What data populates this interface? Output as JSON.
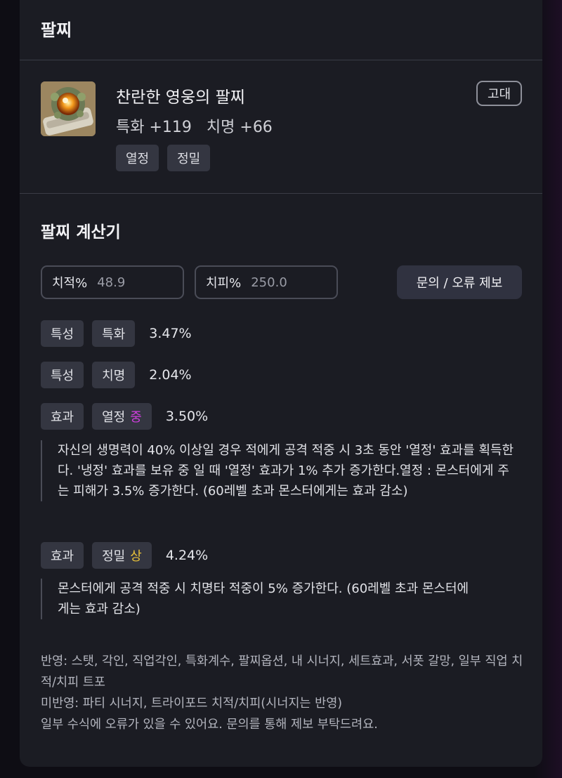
{
  "header": {
    "title": "팔찌"
  },
  "item": {
    "name": "찬란한 영웅의 팔찌",
    "stats": [
      "특화 +119",
      "치명 +66"
    ],
    "tags": [
      "열정",
      "정밀"
    ],
    "grade": "고대"
  },
  "calculator": {
    "title": "팔찌 계산기",
    "crit_rate": {
      "label": "치적%",
      "value": "48.9"
    },
    "crit_damage": {
      "label": "치피%",
      "value": "250.0"
    },
    "report_button": "문의 / 오류 제보",
    "rows": [
      {
        "kind": "특성",
        "name": "특화",
        "value": "3.47%"
      },
      {
        "kind": "특성",
        "name": "치명",
        "value": "2.04%"
      },
      {
        "kind": "효과",
        "name": "열정",
        "grade": "중",
        "value": "3.50%",
        "desc": "자신의 생명력이 40% 이상일 경우 적에게 공격 적중 시 3초 동안 '열정' 효과를 획득한다. '냉정' 효과를 보유 중 일 때 '열정' 효과가 1% 추가 증가한다.열정 : 몬스터에게 주는 피해가 3.5% 증가한다. (60레벨 초과 몬스터에게는 효과 감소)"
      },
      {
        "kind": "효과",
        "name": "정밀",
        "grade": "상",
        "value": "4.24%",
        "desc": "몬스터에게 공격 적중 시 치명타 적중이 5% 증가한다. (60레벨 초과 몬스터에게는 효과 감소)"
      }
    ],
    "footer": [
      "반영: 스탯, 각인, 직업각인, 특화계수, 팔찌옵션, 내 시너지, 세트효과, 서폿 갈망, 일부 직업 치적/치피 트포",
      "미반영: 파티 시너지, 트라이포드 치적/치피(시너지는 반영)",
      "일부 수식에 오류가 있을 수 있어요. 문의를 통해 제보 부탁드려요."
    ]
  },
  "colors": {
    "grade_mid": "#d23fe0",
    "grade_high": "#e8c13a",
    "card_bg": "#1b1c23"
  },
  "icons": {
    "item": "bracelet-icon"
  }
}
